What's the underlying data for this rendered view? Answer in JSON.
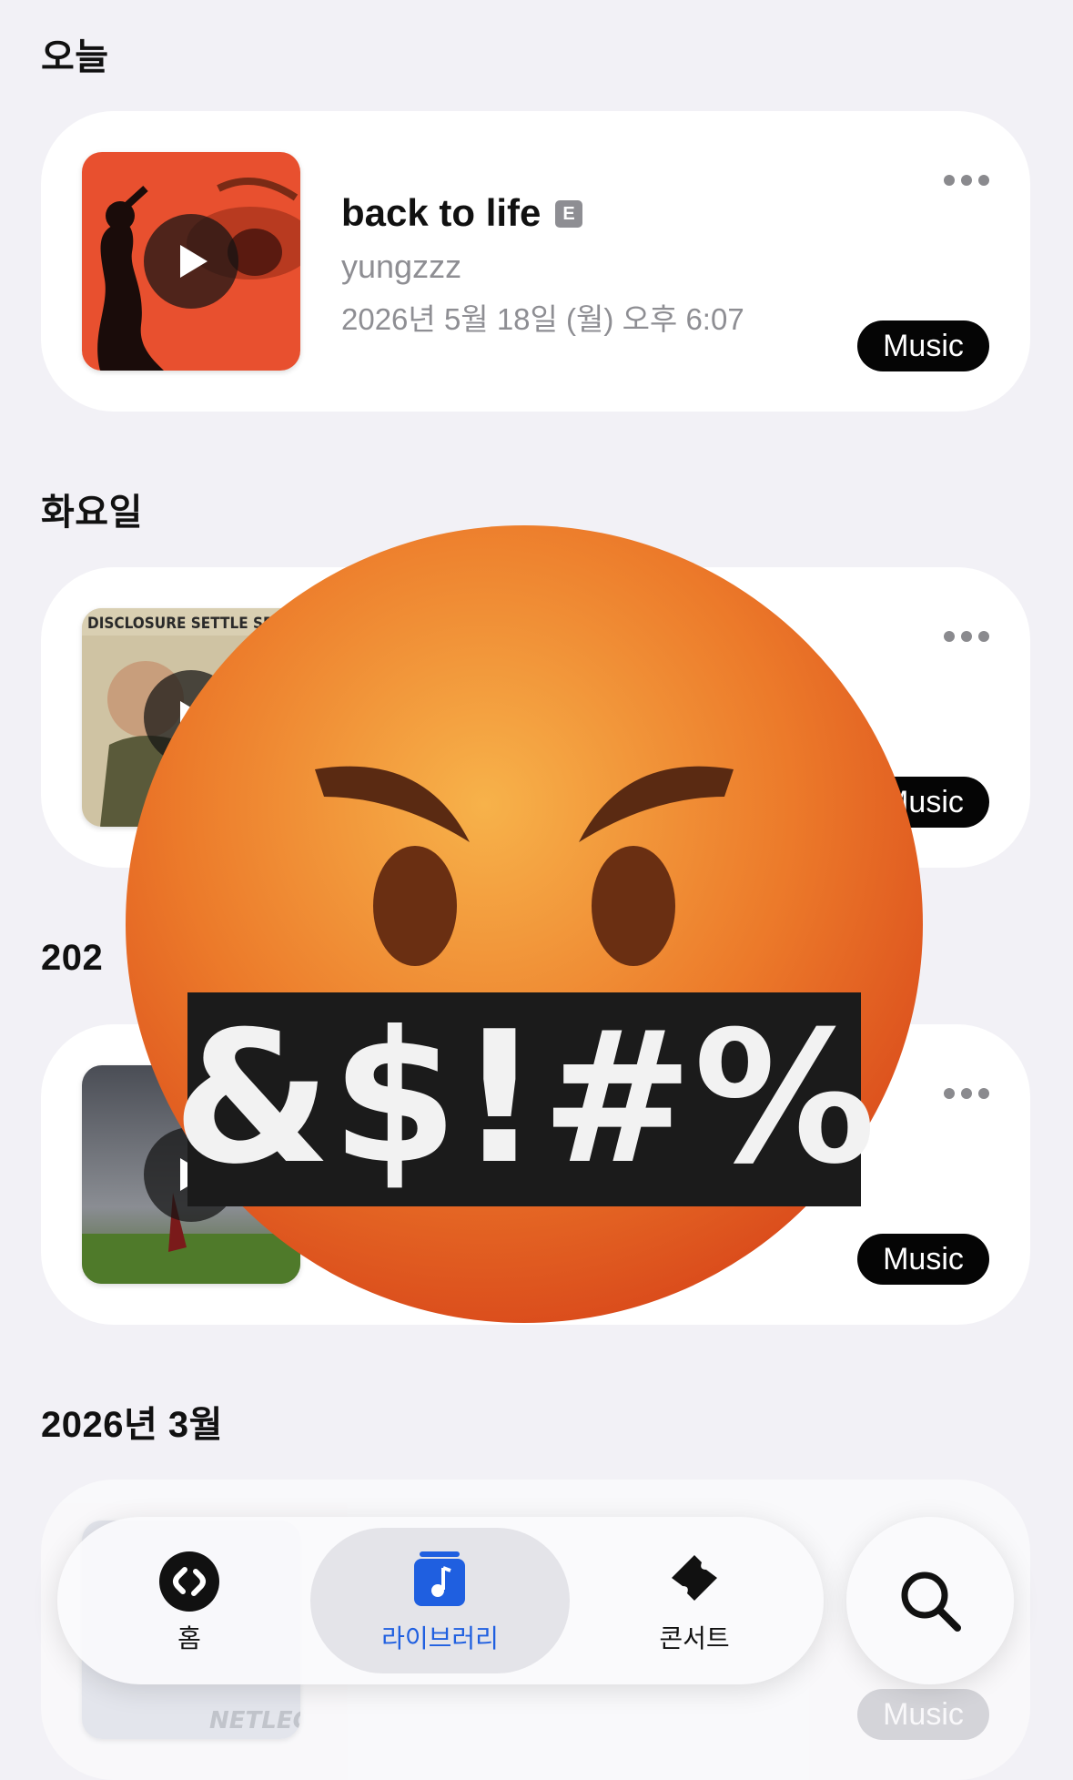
{
  "sections": [
    {
      "title": "오늘",
      "track": {
        "title": "back to life",
        "explicit": "E",
        "artist": "yungzzz",
        "date": "2026년 5월 18일 (월) 오후 6:07",
        "badge": "Music"
      }
    },
    {
      "title": "화요일",
      "track": {
        "art_text": "DISCLOSURE SETTLE SPECIAL ED",
        "badge": "Music"
      }
    },
    {
      "title": "202",
      "track": {
        "badge": "Music"
      }
    },
    {
      "title": "2026년 3월",
      "track": {
        "art_text": "NETLEG",
        "badge": "Music"
      }
    }
  ],
  "overlay": {
    "text": "&$!#%",
    "icon": "angry-face-symbols-emoji"
  },
  "tabbar": {
    "tabs": [
      {
        "label": "홈",
        "icon": "shazam-icon"
      },
      {
        "label": "라이브러리",
        "icon": "music-note-icon"
      },
      {
        "label": "콘서트",
        "icon": "ticket-icon"
      }
    ],
    "active_index": 1,
    "search_icon": "search-icon"
  },
  "colors": {
    "background": "#f2f1f6",
    "accent": "#1f5fe0",
    "secondary_text": "#8e8e93"
  }
}
